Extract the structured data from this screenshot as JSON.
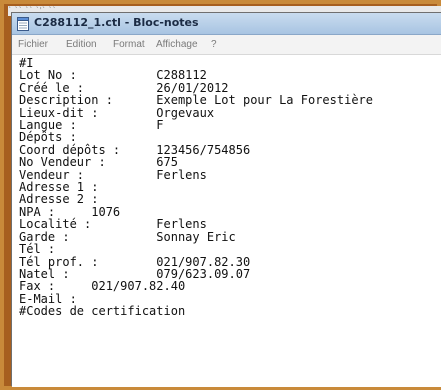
{
  "background_strip": "`             ``              ``         `'`  ``",
  "window": {
    "title": "C288112_1.ctl - Bloc-notes",
    "icon": "notepad-icon"
  },
  "menu": {
    "items": [
      {
        "label": "Fichier"
      },
      {
        "label": "Edition"
      },
      {
        "label": "Format"
      },
      {
        "label": "Affichage"
      },
      {
        "label": "?"
      }
    ]
  },
  "content": "#I\nLot No :           C288112\nCréé le :          26/01/2012\nDescription :      Exemple Lot pour La Forestière\nLieux-dit :        Orgevaux\nLangue :           F\nDépôts :\nCoord dépôts :     123456/754856\nNo Vendeur :       675\nVendeur :          Ferlens\nAdresse 1 :\nAdresse 2 :\nNPA :     1076\nLocalité :         Ferlens\nGarde :            Sonnay Eric\nTél :\nTél prof. :        021/907.82.30\nNatel :            079/623.09.07\nFax :     021/907.82.40\nE-Mail :\n#Codes de certification",
  "colors": {
    "frame": "#c98a3a",
    "titlebar": "#b9d1ea",
    "menu_text": "#7a7a7a"
  }
}
